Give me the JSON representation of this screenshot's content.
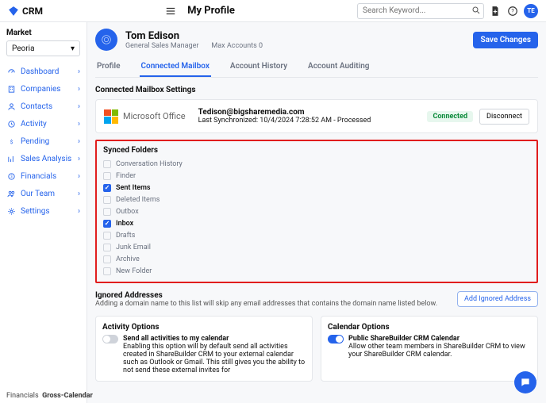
{
  "brand": "CRM",
  "page_title": "My Profile",
  "search": {
    "placeholder": "Search Keyword..."
  },
  "avatar_initials": "TE",
  "market": {
    "label": "Market",
    "value": "Peoria"
  },
  "sidebar": {
    "items": [
      {
        "label": "Dashboard"
      },
      {
        "label": "Companies"
      },
      {
        "label": "Contacts"
      },
      {
        "label": "Activity"
      },
      {
        "label": "Pending"
      },
      {
        "label": "Sales Analysis"
      },
      {
        "label": "Financials"
      },
      {
        "label": "Our Team"
      },
      {
        "label": "Settings"
      }
    ]
  },
  "profile": {
    "name": "Tom Edison",
    "role": "General Sales Manager",
    "max_accounts": "Max Accounts 0",
    "save_label": "Save Changes"
  },
  "tabs": [
    {
      "label": "Profile"
    },
    {
      "label": "Connected Mailbox"
    },
    {
      "label": "Account History"
    },
    {
      "label": "Account Auditing"
    }
  ],
  "mailbox": {
    "section_title": "Connected Mailbox Settings",
    "provider": "Microsoft Office",
    "email": "Tedison@bigsharemedia.com",
    "synced_line": "Last Synchronized: 10/4/2024 7:28:52 AM - Processed",
    "status": "Connected",
    "disconnect": "Disconnect"
  },
  "synced": {
    "title": "Synced Folders",
    "folders": [
      {
        "label": "Conversation History",
        "checked": false
      },
      {
        "label": "Finder",
        "checked": false
      },
      {
        "label": "Sent Items",
        "checked": true
      },
      {
        "label": "Deleted Items",
        "checked": false
      },
      {
        "label": "Outbox",
        "checked": false
      },
      {
        "label": "Inbox",
        "checked": true
      },
      {
        "label": "Drafts",
        "checked": false
      },
      {
        "label": "Junk Email",
        "checked": false
      },
      {
        "label": "Archive",
        "checked": false
      },
      {
        "label": "New Folder",
        "checked": false
      }
    ]
  },
  "ignored": {
    "title": "Ignored Addresses",
    "desc": "Adding a domain name to this list will skip any email addresses that contains the domain name listed below.",
    "button": "Add Ignored Address"
  },
  "activity_options": {
    "title": "Activity Options",
    "item_title": "Send all activities to my calendar",
    "item_desc": "Enabling this option will by default send all activities created in ShareBuilder CRM to your external calendar such as Outlook or Gmail. This still gives you the ability to not send these external invites for"
  },
  "calendar_options": {
    "title": "Calendar Options",
    "item_title": "Public ShareBuilder CRM Calendar",
    "item_desc": "Allow other team members in ShareBuilder CRM to view your ShareBuilder CRM calendar."
  },
  "footer": {
    "left": "Financials",
    "right": "Gross-Calendar"
  }
}
